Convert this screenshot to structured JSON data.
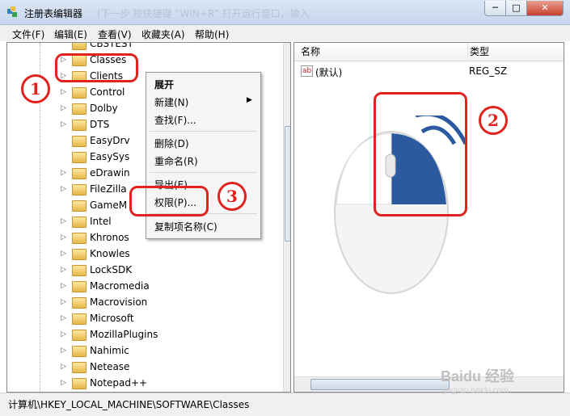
{
  "window": {
    "title": "注册表编辑器",
    "title_background_text": "(下一步 按快捷键 “WIN+R” 打开运行窗口，输入",
    "buttons": {
      "minimize": "─",
      "maximize": "□",
      "close": "✕"
    }
  },
  "menu": [
    "文件(F)",
    "编辑(E)",
    "查看(V)",
    "收藏夹(A)",
    "帮助(H)"
  ],
  "tree": {
    "items": [
      {
        "label": "CBSTEST",
        "arrow": ""
      },
      {
        "label": "Classes",
        "arrow": "▷"
      },
      {
        "label": "Clients",
        "arrow": "▷"
      },
      {
        "label": "Control",
        "arrow": "▷"
      },
      {
        "label": "Dolby",
        "arrow": "▷"
      },
      {
        "label": "DTS",
        "arrow": "▷"
      },
      {
        "label": "EasyDrv",
        "arrow": ""
      },
      {
        "label": "EasySys",
        "arrow": ""
      },
      {
        "label": "eDrawin",
        "arrow": "▷"
      },
      {
        "label": "FileZilla",
        "arrow": "▷"
      },
      {
        "label": "GameM",
        "arrow": ""
      },
      {
        "label": "Intel",
        "arrow": "▷"
      },
      {
        "label": "Khronos",
        "arrow": "▷"
      },
      {
        "label": "Knowles",
        "arrow": "▷"
      },
      {
        "label": "LockSDK",
        "arrow": "▷"
      },
      {
        "label": "Macromedia",
        "arrow": "▷"
      },
      {
        "label": "Macrovision",
        "arrow": "▷"
      },
      {
        "label": "Microsoft",
        "arrow": "▷"
      },
      {
        "label": "MozillaPlugins",
        "arrow": "▷"
      },
      {
        "label": "Nahimic",
        "arrow": "▷"
      },
      {
        "label": "Netease",
        "arrow": "▷"
      },
      {
        "label": "Notepad++",
        "arrow": "▷"
      }
    ]
  },
  "list": {
    "headers": {
      "name": "名称",
      "type": "类型"
    },
    "rows": [
      {
        "name": "(默认)",
        "type": "REG_SZ",
        "icon": "ab"
      }
    ]
  },
  "context_menu": {
    "expand": "展开",
    "new": "新建(N)",
    "find": "查找(F)...",
    "delete": "删除(D)",
    "rename": "重命名(R)",
    "export": "导出(E)",
    "permissions": "权限(P)...",
    "copy_key_name": "复制项名称(C)"
  },
  "status": {
    "path": "计算机\\HKEY_LOCAL_MACHINE\\SOFTWARE\\Classes"
  },
  "annotations": {
    "step1": "1",
    "step2": "2",
    "step3": "3",
    "color": "#e0231e"
  },
  "watermark": {
    "main": "Baidu 经验",
    "sub": "jingyan.baidu.com"
  },
  "colors": {
    "mouse_button": "#2c5aa0",
    "highlight": "#e0231e"
  }
}
